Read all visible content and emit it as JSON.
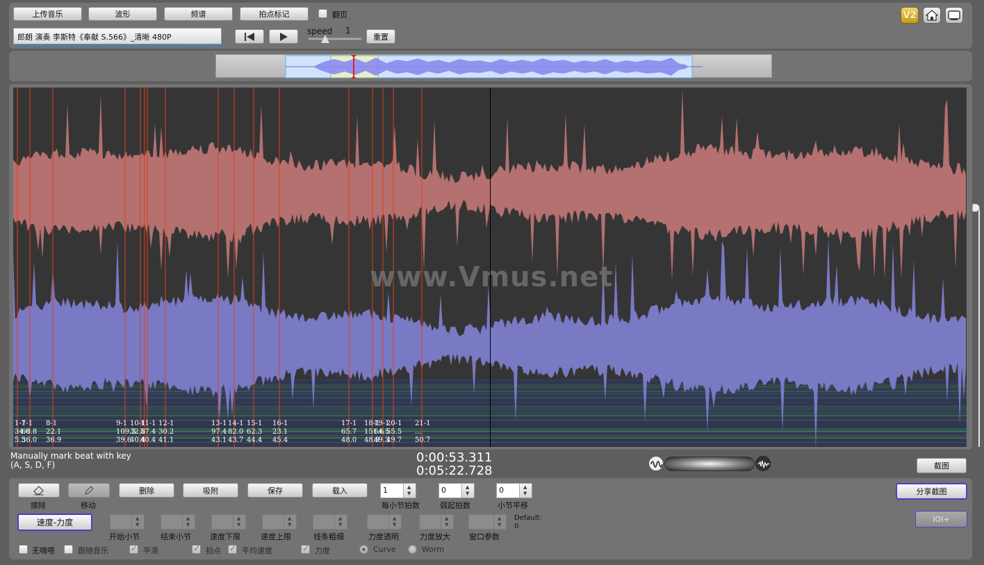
{
  "toolbar": {
    "upload_label": "上传音乐",
    "waveform_label": "波形",
    "spectrum_label": "频谱",
    "beatmark_label": "拍点标记",
    "pageturn_label": "翻页",
    "filename": "郎朗 演奏 李斯特《奉献 S.566》_清晰 480P",
    "speed_label": "speed",
    "speed_value": "1",
    "reset_label": "重置",
    "v2_label": "V2"
  },
  "main": {
    "watermark": "www.Vmus.net",
    "beat_markers": [
      {
        "l1": "1-1",
        "l2": "34.0",
        "l3": "5.5"
      },
      {
        "l1": "7-1",
        "l2": "68.8",
        "l3": "36.0"
      },
      {
        "l1": "8-1",
        "l2": "22.1",
        "l3": "36.9"
      },
      {
        "l1": "9-1",
        "l2": "109.3",
        "l3": "39.6"
      },
      {
        "l1": "10-1",
        "l2": "32.8",
        "l3": "40.4"
      },
      {
        "l1": "11-1",
        "l2": "57.4",
        "l3": "40.4"
      },
      {
        "l1": "12-1",
        "l2": "30.2",
        "l3": "41.1"
      },
      {
        "l1": "13-1",
        "l2": "97.4",
        "l3": "43.1"
      },
      {
        "l1": "14-1",
        "l2": "82.0",
        "l3": "43.7"
      },
      {
        "l1": "15-1",
        "l2": "62.3",
        "l3": "44.4"
      },
      {
        "l1": "16-1",
        "l2": "23.1",
        "l3": "45.4"
      },
      {
        "l1": "17-1",
        "l2": "65.7",
        "l3": "48.0"
      },
      {
        "l1": "18-1",
        "l2": "151.6",
        "l3": "48.9"
      },
      {
        "l1": "19-1",
        "l2": "64.5",
        "l3": "49.3"
      },
      {
        "l1": "20-1",
        "l2": "55.5",
        "l3": "49.7"
      },
      {
        "l1": "21-1",
        "l2": "...",
        "l3": "50.7"
      }
    ]
  },
  "status": {
    "hint_line1": "Manually mark beat with key",
    "hint_line2": "(A, S, D, F)",
    "current_time": "0:00:53.311",
    "total_time": "0:05:22.728",
    "screenshot_label": "截图"
  },
  "controls": {
    "erase_label": "擦除",
    "move_label": "移动",
    "delete_label": "删除",
    "snap_label": "吸附",
    "save_label": "保存",
    "load_label": "载入",
    "beats_per_bar_value": "1",
    "beats_per_bar_label": "每小节拍数",
    "pickup_value": "0",
    "pickup_label": "弱起拍数",
    "bar_offset_value": "0",
    "bar_offset_label": "小节平移",
    "share_label": "分享截图",
    "ioi_label": "IOI+",
    "speed_dyn_label": "速度-力度",
    "start_bar_label": "开始小节",
    "end_bar_label": "结束小节",
    "speed_low_label": "速度下限",
    "speed_high_label": "速度上限",
    "line_width_label": "线条粗细",
    "dyn_opacity_label": "力度透明",
    "dyn_zoom_label": "力度放大",
    "window_param_label": "窗口参数",
    "default_label": "Default:",
    "default_value": "0",
    "no_metronome_label": "无嘀嗒",
    "follow_music_label": "跟随音乐",
    "smooth_label": "平滑",
    "beat_point_label": "拍点",
    "avg_speed_label": "平均速度",
    "dynamics_label": "力度",
    "curve_label": "Curve",
    "worm_label": "Worm"
  },
  "colors": {
    "upper_wave": "#b57070",
    "lower_wave": "#7a79c4",
    "beat_line": "#e0401a",
    "canvas_bg": "#353535",
    "accent": "#4b3fc6"
  }
}
